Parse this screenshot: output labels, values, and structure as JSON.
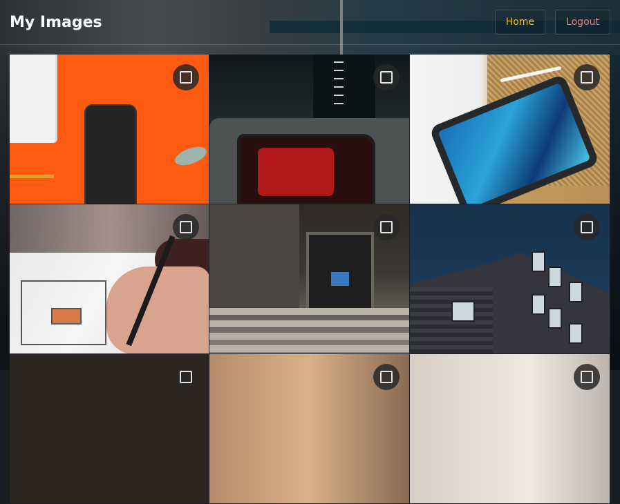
{
  "header": {
    "title": "My Images",
    "nav": {
      "home_label": "Home",
      "logout_label": "Logout"
    }
  },
  "colors": {
    "home": "#f3c11c",
    "logout": "#f08080"
  },
  "gallery": {
    "images": [
      {
        "subject": "phone-on-orange"
      },
      {
        "subject": "car-interior-red"
      },
      {
        "subject": "tablet-on-mat"
      },
      {
        "subject": "hand-drawing-sketch"
      },
      {
        "subject": "building-entrance"
      },
      {
        "subject": "modern-building"
      },
      {
        "subject": "partial-dark"
      },
      {
        "subject": "partial-fabric"
      },
      {
        "subject": "partial-light"
      }
    ]
  }
}
